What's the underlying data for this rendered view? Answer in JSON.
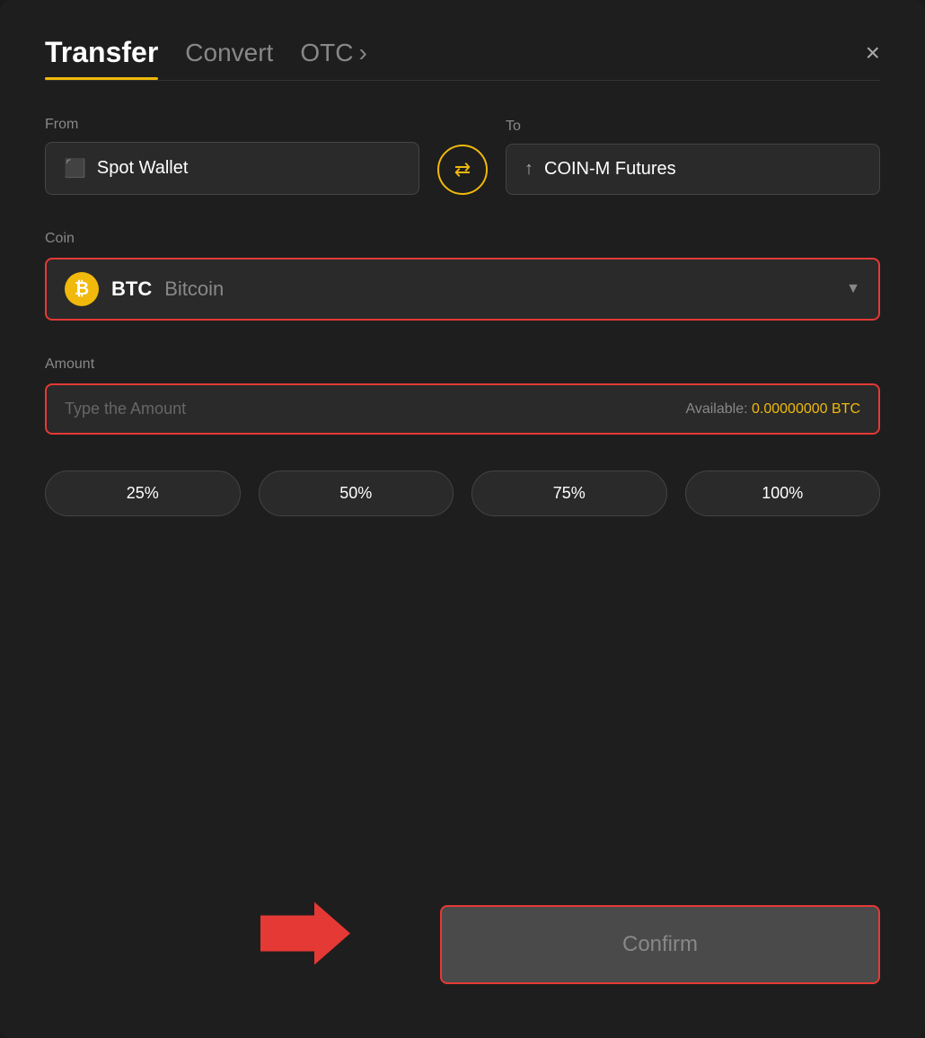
{
  "header": {
    "tab_transfer": "Transfer",
    "tab_convert": "Convert",
    "tab_otc": "OTC",
    "close_label": "×"
  },
  "from_section": {
    "label": "From",
    "wallet_label": "Spot Wallet"
  },
  "to_section": {
    "label": "To",
    "wallet_label": "COIN-M Futures"
  },
  "coin_section": {
    "label": "Coin",
    "coin_symbol": "BTC",
    "coin_name": "Bitcoin",
    "btc_letter": "₿"
  },
  "amount_section": {
    "label": "Amount",
    "placeholder": "Type the Amount",
    "available_label": "Available:",
    "available_value": "0.00000000",
    "available_currency": "BTC"
  },
  "percent_buttons": [
    {
      "label": "25%"
    },
    {
      "label": "50%"
    },
    {
      "label": "75%"
    },
    {
      "label": "100%"
    }
  ],
  "confirm_button": {
    "label": "Confirm"
  },
  "colors": {
    "accent_yellow": "#f0b90b",
    "accent_red": "#e53935",
    "bg_dark": "#1e1e1e",
    "text_muted": "#888888"
  }
}
